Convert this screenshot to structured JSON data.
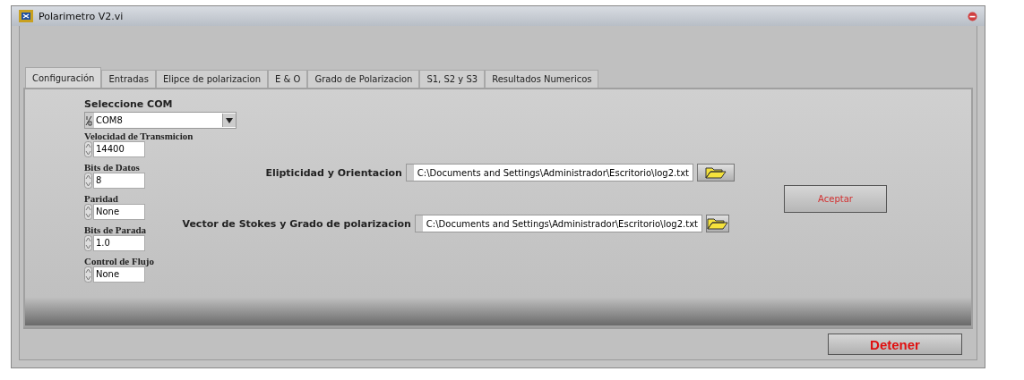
{
  "window": {
    "title": "Polarimetro V2.vi"
  },
  "tabs": [
    {
      "label": "Configuración",
      "selected": true
    },
    {
      "label": "Entradas",
      "selected": false
    },
    {
      "label": "Elipce de polarizacion",
      "selected": false
    },
    {
      "label": "E & O",
      "selected": false
    },
    {
      "label": "Grado de Polarizacion",
      "selected": false
    },
    {
      "label": "S1, S2 y S3",
      "selected": false
    },
    {
      "label": "Resultados Numericos",
      "selected": false
    }
  ],
  "com": {
    "label": "Seleccione COM",
    "value": "COM8"
  },
  "fields": [
    {
      "label": "Velocidad de Transmicion",
      "value": "14400"
    },
    {
      "label": "Bits de Datos",
      "value": "8"
    },
    {
      "label": "Paridad",
      "value": "None"
    },
    {
      "label": "Bits de Parada",
      "value": "1.0"
    },
    {
      "label": "Control de Flujo",
      "value": "None"
    }
  ],
  "paths": [
    {
      "label": "Elipticidad y Orientacion",
      "value": "C:\\Documents and Settings\\Administrador\\Escritorio\\log2.txt"
    },
    {
      "label": "Vector de Stokes y Grado de polarizacion",
      "value": "C:\\Documents and Settings\\Administrador\\Escritorio\\log2.txt"
    }
  ],
  "accept_button": "Aceptar",
  "stop_button": "Detener"
}
